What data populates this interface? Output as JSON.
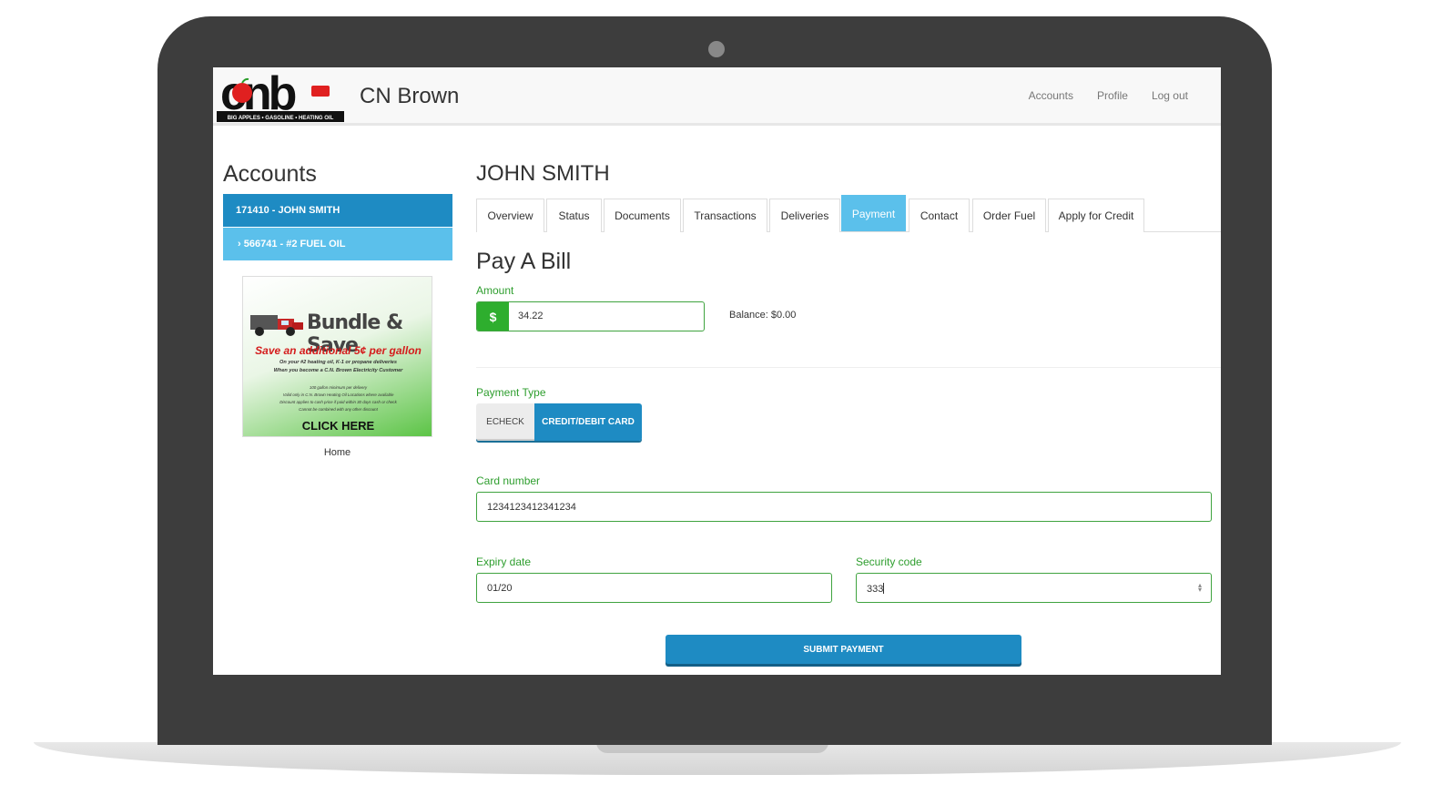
{
  "brand": {
    "name": "CN Brown",
    "logo_letters": "cnb",
    "logo_tagline": "BIG APPLES • GASOLINE • HEATING OIL"
  },
  "nav": {
    "links": [
      "Accounts",
      "Profile",
      "Log out"
    ]
  },
  "sidebar": {
    "title": "Accounts",
    "active_account": "171410 - JOHN SMITH",
    "sub_account": "566741 - #2 FUEL OIL",
    "promo": {
      "title": "Bundle & Save",
      "headline": "Save an additional 5¢ per gallon",
      "line1": "On your #2 heating oil, K-1 or propane deliveries",
      "line2": "When you become a C.N. Brown Electricity Customer",
      "fine1": "100 gallon minimum per delivery",
      "fine2": "Valid only in C.N. Brown Heating Oil Locations where available",
      "fine3": "Discount applies to cash price if paid within 30 days cash or check",
      "fine4": "Cannot be combined with any other discount",
      "cta": "CLICK HERE"
    },
    "promo_caption": "Home"
  },
  "main": {
    "customer_name": "JOHN SMITH",
    "tabs": [
      "Overview",
      "Status",
      "Documents",
      "Transactions",
      "Deliveries",
      "Payment",
      "Contact",
      "Order Fuel",
      "Apply for Credit"
    ],
    "active_tab": "Payment",
    "section_title": "Pay A Bill",
    "amount": {
      "label": "Amount",
      "prefix": "$",
      "value": "34.22"
    },
    "balance": "Balance: $0.00",
    "payment_type": {
      "label": "Payment Type",
      "options": [
        "ECHECK",
        "CREDIT/DEBIT CARD"
      ],
      "selected": "CREDIT/DEBIT CARD"
    },
    "card_number": {
      "label": "Card number",
      "value": "1234123412341234"
    },
    "expiry": {
      "label": "Expiry date",
      "value": "01/20"
    },
    "security": {
      "label": "Security code",
      "value": "333"
    },
    "submit_label": "SUBMIT PAYMENT"
  },
  "colors": {
    "primary": "#1e8bc3",
    "light_primary": "#5bc0eb",
    "success": "#2eae2e",
    "frame": "#3d3d3d"
  }
}
